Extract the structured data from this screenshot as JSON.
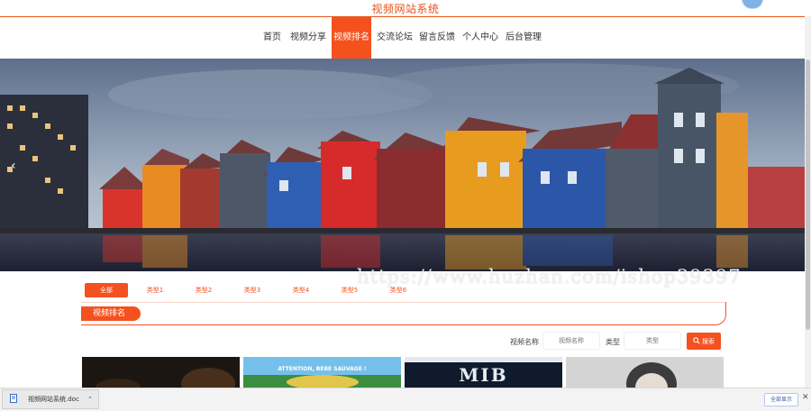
{
  "site": {
    "title": "视频网站系统"
  },
  "nav": {
    "items": [
      "首页",
      "视频分享",
      "视频排名",
      "交流论坛",
      "留言反馈",
      "个人中心",
      "后台管理"
    ],
    "active_index": 2
  },
  "banner": {
    "watermark": "https://www.huzhan.com/ishop39397",
    "prev_glyph": "‹"
  },
  "tabs": {
    "items": [
      "全部",
      "类型1",
      "类型2",
      "类型3",
      "类型4",
      "类型5",
      "类型6"
    ],
    "active_index": 0
  },
  "section": {
    "title": "视频排名"
  },
  "filter": {
    "name_label": "视频名称",
    "name_placeholder": "视频名称",
    "type_label": "类型",
    "type_placeholder": "类型",
    "search_label": "搜索"
  },
  "cards": [
    {
      "title": ""
    },
    {
      "title": "ATTENTION, BEBE SAUVAGE !"
    },
    {
      "title": "MIB"
    },
    {
      "title": ""
    }
  ],
  "download_bar": {
    "file_name": "视频网站系统.doc",
    "show_all": "全部显示",
    "close_glyph": "✕"
  },
  "colors": {
    "accent": "#f4511e",
    "title": "#e8501a"
  }
}
